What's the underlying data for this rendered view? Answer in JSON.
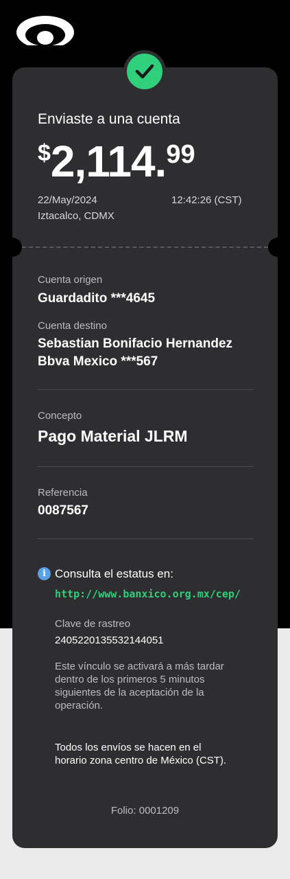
{
  "brand": {
    "logo_icon": "bank-logo-icon"
  },
  "status": {
    "icon": "check-icon",
    "color": "#2fcf7c"
  },
  "header": {
    "title": "Enviaste a una cuenta",
    "amount": {
      "currency": "$",
      "integer": "2,114.",
      "decimals": "99"
    },
    "date": "22/May/2024",
    "time": "12:42:26 (CST)",
    "location": "Iztacalco, CDMX"
  },
  "details": {
    "origin": {
      "label": "Cuenta origen",
      "value": "Guardadito ***4645"
    },
    "destination": {
      "label": "Cuenta destino",
      "name": "Sebastian Bonifacio Hernandez",
      "bank": "Bbva Mexico ***567"
    },
    "concept": {
      "label": "Concepto",
      "value": "Pago Material JLRM"
    },
    "reference": {
      "label": "Referencia",
      "value": "0087567"
    }
  },
  "status_info": {
    "heading": "Consulta el estatus en:",
    "link": "http://www.banxico.org.mx/cep/",
    "tracking_label": "Clave de rastreo",
    "tracking_value": "2405220135532144051",
    "note_lines": [
      "Este vínculo se activará a más tardar",
      "dentro de los primeros 5 minutos",
      "siguientes de la aceptación de la",
      "operación."
    ],
    "schedule_lines": [
      "Todos los envíos se hacen en el",
      "horario zona centro de México (CST)."
    ]
  },
  "folio": "Folio: 0001209"
}
